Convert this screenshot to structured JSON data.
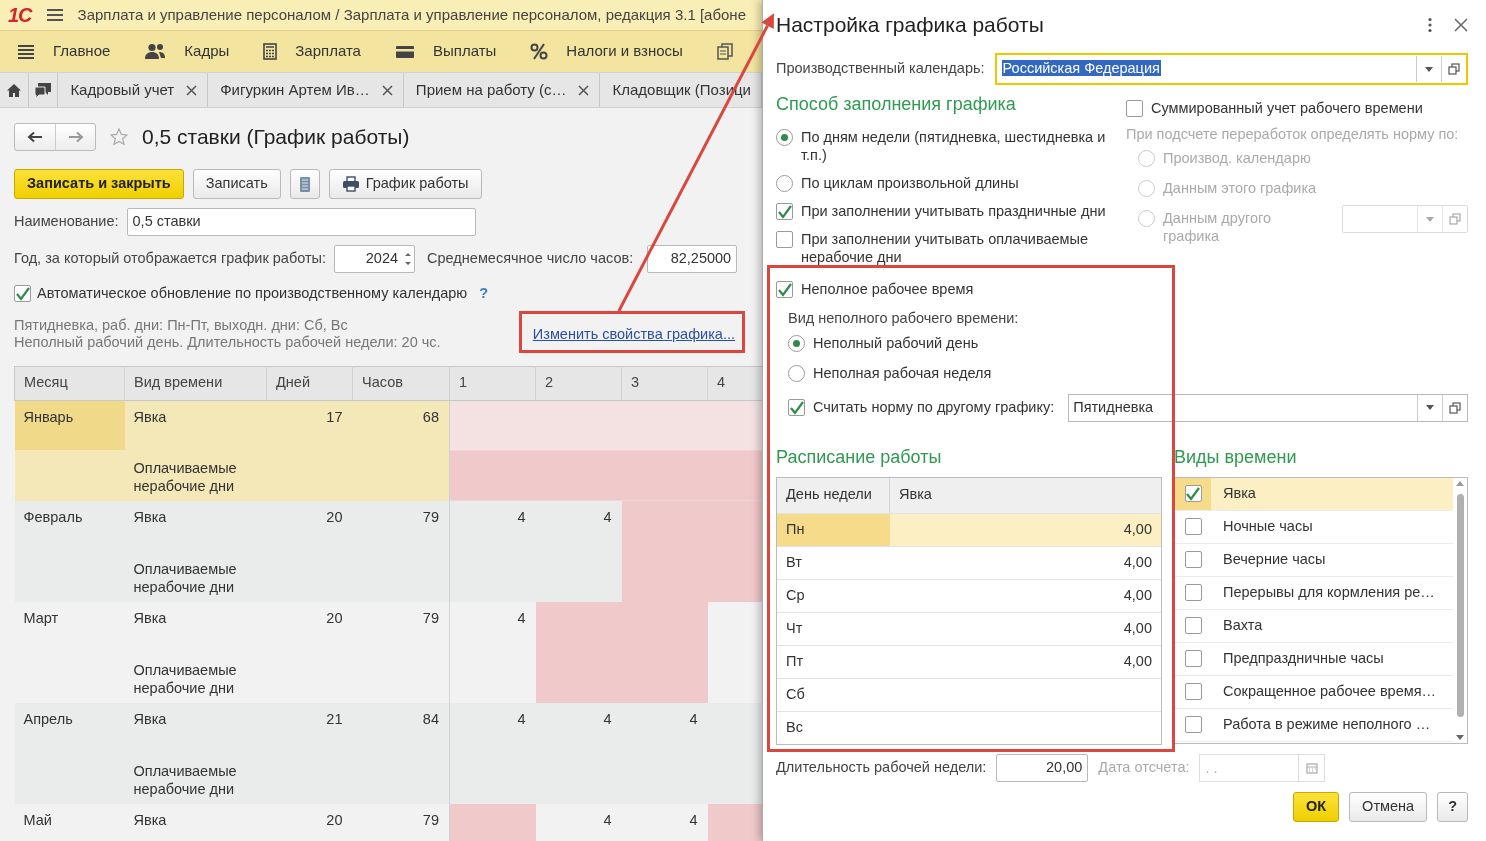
{
  "app": {
    "logo": "1С",
    "title": "Зарплата и управление персоналом / Зарплата и управление персоналом, редакция 3.1 [абоне",
    "sections": [
      {
        "kind": "list",
        "label": "Главное"
      },
      {
        "kind": "people",
        "label": "Кадры"
      },
      {
        "kind": "calculator",
        "label": "Зарплата"
      },
      {
        "kind": "card",
        "label": "Выплаты"
      },
      {
        "kind": "percent",
        "label": "Налоги и взносы"
      },
      {
        "kind": "copy"
      }
    ],
    "open_tabs": [
      {
        "kind": "home"
      },
      {
        "kind": "chat"
      },
      {
        "kind": "page",
        "label": "Кадровый учет",
        "closable": true
      },
      {
        "kind": "page",
        "label": "Фигуркин Артем Ив…",
        "closable": true
      },
      {
        "kind": "page",
        "label": "Прием на работу (с…",
        "closable": true
      },
      {
        "kind": "page",
        "label": "Кладовщик (Позици",
        "closable": false
      }
    ]
  },
  "form": {
    "title": "0,5 ставки (График работы)",
    "favorite": false,
    "buttons": [
      {
        "kind": "primary",
        "label": "Записать и закрыть"
      },
      {
        "kind": "plain",
        "label": "Записать"
      },
      {
        "kind": "document"
      },
      {
        "kind": "print",
        "label": "График работы"
      }
    ],
    "name": {
      "label": "Наименование:",
      "value": "0,5 ставки"
    },
    "year": {
      "label": "Год, за который отображается график работы:",
      "value": "2024"
    },
    "avg_hours": {
      "label": "Среднемесячное число часов:",
      "value": "82,25000"
    },
    "auto_update": {
      "label": "Автоматическое обновление по производственному календарю",
      "checked": true,
      "help": "?"
    },
    "summary": [
      "Пятидневка, раб. дни: Пн-Пт, выходн. дни: Сб, Вс",
      "Неполный рабочий день. Длительность рабочей недели: 20 чс."
    ],
    "edit_link": {
      "label": "Изменить свойства графика...",
      "highlighted": true
    },
    "table": {
      "columns": [
        "Месяц",
        "Вид времени",
        "Дней",
        "Часов",
        "1",
        "2",
        "3",
        "4"
      ],
      "months": [
        {
          "month": "Январь",
          "selected": true,
          "lines": [
            {
              "time_type": "Явка",
              "days": "17",
              "hours": "68"
            },
            {
              "time_type": "Оплачиваемые нерабочие дни"
            }
          ],
          "dates": [
            {
              "holiday": true
            },
            {
              "holiday": true
            },
            {
              "holiday": true
            },
            {
              "holiday": true
            }
          ]
        },
        {
          "month": "Февраль",
          "selected": false,
          "lines": [
            {
              "time_type": "Явка",
              "days": "20",
              "hours": "79"
            },
            {
              "time_type": "Оплачиваемые нерабочие дни"
            }
          ],
          "dates": [
            {
              "value": "4",
              "holiday": false
            },
            {
              "value": "4",
              "holiday": false
            },
            {
              "holiday": true
            },
            {
              "holiday": true
            }
          ]
        },
        {
          "month": "Март",
          "selected": false,
          "lines": [
            {
              "time_type": "Явка",
              "days": "20",
              "hours": "79"
            },
            {
              "time_type": "Оплачиваемые нерабочие дни"
            }
          ],
          "dates": [
            {
              "value": "4",
              "holiday": false
            },
            {
              "holiday": true
            },
            {
              "holiday": true
            },
            {
              "holiday": false
            }
          ]
        },
        {
          "month": "Апрель",
          "selected": false,
          "lines": [
            {
              "time_type": "Явка",
              "days": "21",
              "hours": "84"
            },
            {
              "time_type": "Оплачиваемые нерабочие дни"
            }
          ],
          "dates": [
            {
              "value": "4",
              "holiday": false
            },
            {
              "value": "4",
              "holiday": false
            },
            {
              "value": "4",
              "holiday": false
            },
            {
              "holiday": false
            }
          ]
        },
        {
          "month": "Май",
          "selected": false,
          "lines": [
            {
              "time_type": "Явка",
              "days": "20",
              "hours": "79"
            }
          ],
          "dates": [
            {
              "holiday": true
            },
            {
              "value": "4",
              "holiday": false
            },
            {
              "value": "4",
              "holiday": false
            },
            {
              "holiday": true
            }
          ]
        }
      ]
    }
  },
  "dialog": {
    "title": "Настройка графика работы",
    "calendar": {
      "label": "Производственный календарь:",
      "value": "Российская Федерация",
      "focused": true
    },
    "fill_method": {
      "heading": "Способ заполнения графика",
      "options": [
        {
          "label": "По дням недели (пятидневка, шестидневка и т.п.)",
          "selected": true
        },
        {
          "label": "По циклам произвольной длины",
          "selected": false
        }
      ],
      "checks": [
        {
          "label": "При заполнении учитывать праздничные дни",
          "checked": true
        },
        {
          "label": "При заполнении учитывать оплачиваемые нерабочие дни",
          "checked": false
        }
      ]
    },
    "summarized": {
      "label": "Суммированный учет рабочего времени",
      "checked": false,
      "note": "При подсчете переработок определять норму по:",
      "disabled": true,
      "options": [
        {
          "label": "Производ. календарю",
          "selected": false
        },
        {
          "label": "Данным этого графика",
          "selected": false
        },
        {
          "label": "Данным другого графика",
          "selected": false,
          "with_field": true
        }
      ]
    },
    "part_time": {
      "label": "Неполное рабочее время",
      "checked": true,
      "highlighted": true,
      "type_label": "Вид неполного рабочего времени:",
      "types": [
        {
          "label": "Неполный рабочий день",
          "selected": true
        },
        {
          "label": "Неполная рабочая неделя",
          "selected": false
        }
      ],
      "norm": {
        "label": "Считать норму по другому графику:",
        "checked": true,
        "value": "Пятидневка"
      }
    },
    "schedule": {
      "heading": "Расписание работы",
      "columns": [
        "День недели",
        "Явка"
      ],
      "rows": [
        {
          "day": "Пн",
          "hours": "4,00",
          "selected": true
        },
        {
          "day": "Вт",
          "hours": "4,00",
          "selected": false
        },
        {
          "day": "Ср",
          "hours": "4,00",
          "selected": false
        },
        {
          "day": "Чт",
          "hours": "4,00",
          "selected": false
        },
        {
          "day": "Пт",
          "hours": "4,00",
          "selected": false
        },
        {
          "day": "Сб",
          "selected": false
        },
        {
          "day": "Вс",
          "selected": false
        }
      ]
    },
    "time_types": {
      "heading": "Виды времени",
      "items": [
        {
          "label": "Явка",
          "checked": true,
          "selected": true
        },
        {
          "label": "Ночные часы",
          "checked": false,
          "selected": false
        },
        {
          "label": "Вечерние часы",
          "checked": false,
          "selected": false
        },
        {
          "label": "Перерывы для кормления ре…",
          "checked": false,
          "selected": false
        },
        {
          "label": "Вахта",
          "checked": false,
          "selected": false
        },
        {
          "label": "Предпраздничные часы",
          "checked": false,
          "selected": false
        },
        {
          "label": "Сокращенное рабочее время…",
          "checked": false,
          "selected": false
        },
        {
          "label": "Работа в режиме неполного …",
          "checked": false,
          "selected": false
        }
      ]
    },
    "week_length": {
      "label": "Длительность рабочей недели:",
      "value": "20,00"
    },
    "start_date": {
      "label": "Дата отсчета:",
      "placeholder": ". .",
      "disabled": true
    },
    "buttons": [
      {
        "kind": "primary",
        "label": "ОК"
      },
      {
        "kind": "plain",
        "label": "Отмена"
      },
      {
        "kind": "help",
        "label": "?"
      }
    ]
  }
}
